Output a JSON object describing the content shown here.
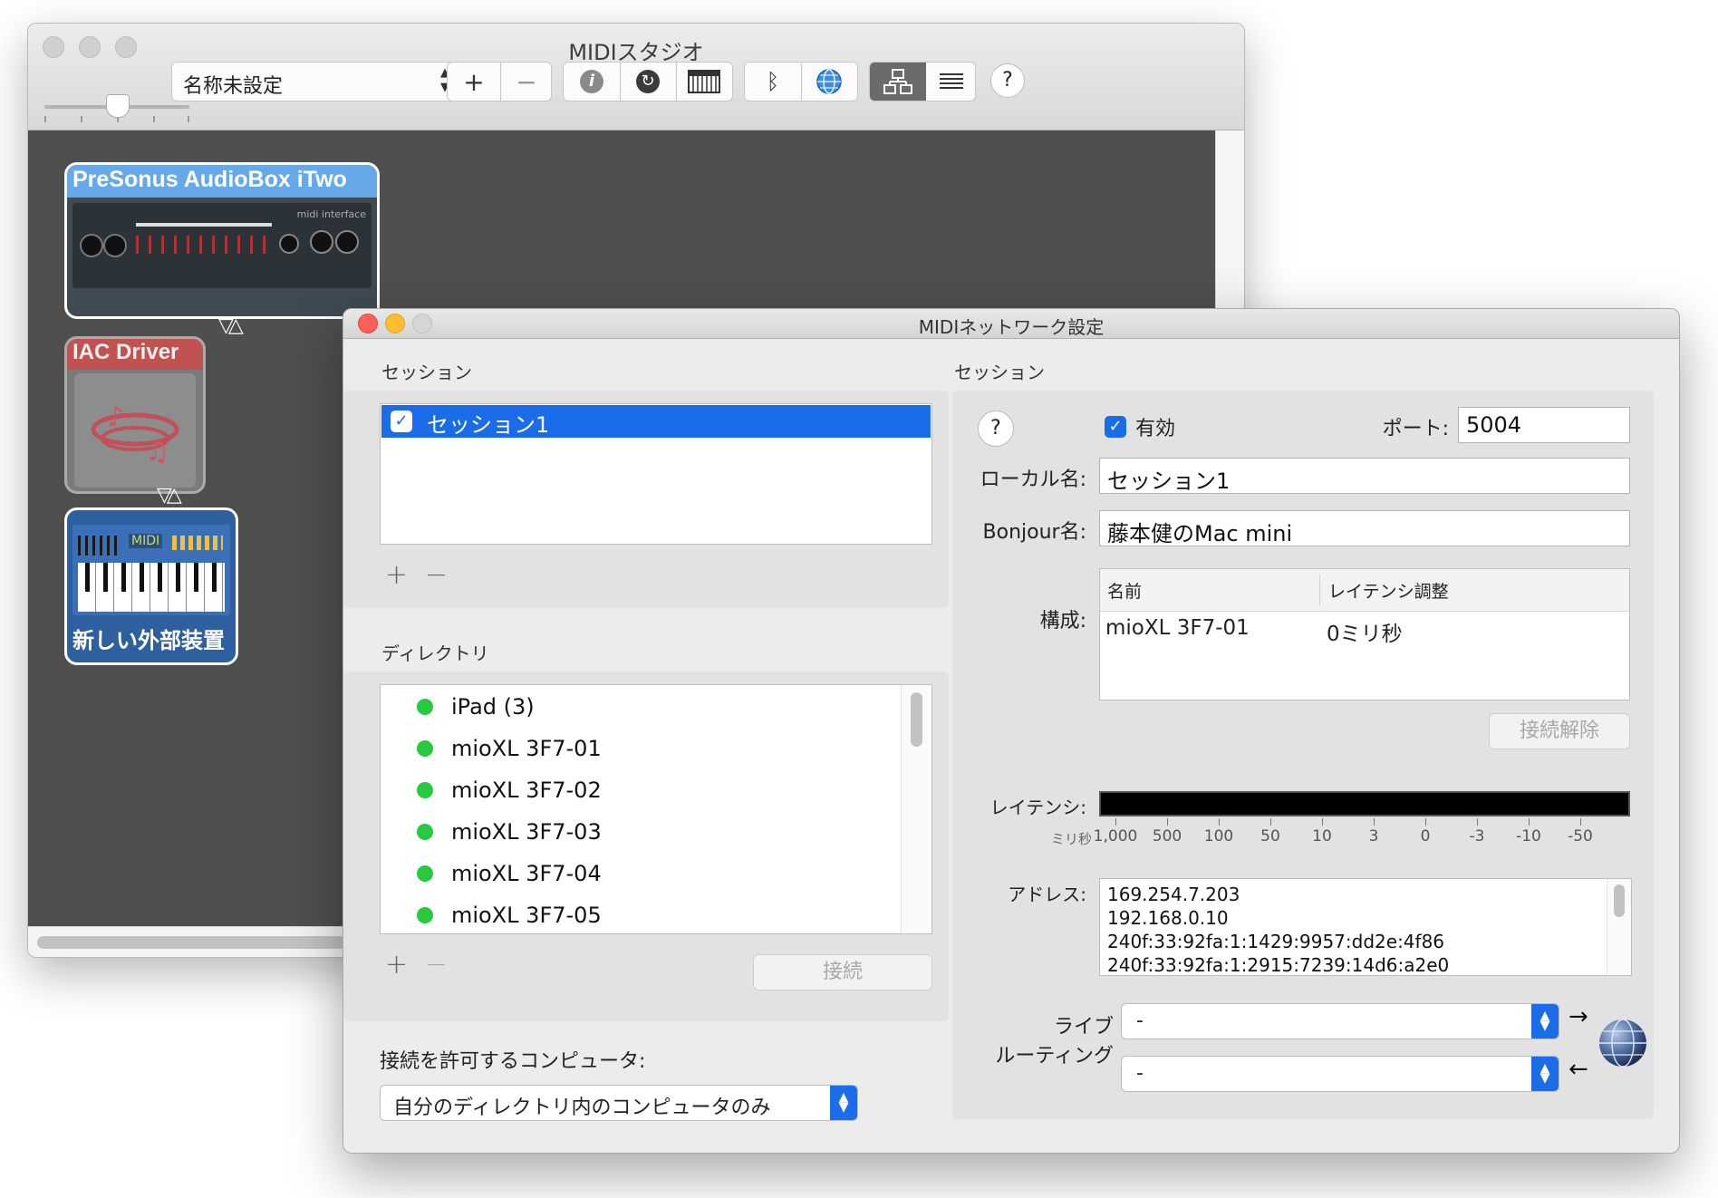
{
  "studio": {
    "title": "MIDIスタジオ",
    "config_select": "名称未設定",
    "add_button": "+",
    "remove_button": "−",
    "help_button": "?",
    "devices": [
      {
        "label": "PreSonus AudioBox iTwo",
        "color": "#66a9e8"
      },
      {
        "label": "IAC Driver",
        "color": "#d94545"
      },
      {
        "label": "新しい外部装置",
        "color": "#2e6fb5"
      }
    ],
    "device_panel_texts": [
      "midi interface",
      "MIDI"
    ]
  },
  "network": {
    "title": "MIDIネットワーク設定",
    "sessions_header": "セッション",
    "sessions": [
      {
        "name": "セッション1",
        "checked": true,
        "selected": true
      }
    ],
    "plus": "+",
    "minus": "−",
    "directory_header": "ディレクトリ",
    "directory": [
      "iPad (3)",
      "mioXL 3F7-01",
      "mioXL 3F7-02",
      "mioXL 3F7-03",
      "mioXL 3F7-04",
      "mioXL 3F7-05"
    ],
    "connect_button": "接続",
    "allow_label": "接続を許可するコンピュータ:",
    "allow_value": "自分のディレクトリ内のコンピュータのみ",
    "session_header": "セッション",
    "help": "?",
    "enabled_label": "有効",
    "enabled": true,
    "port_label": "ポート:",
    "port_value": "5004",
    "local_name_label": "ローカル名:",
    "local_name_value": "セッション1",
    "bonjour_label": "Bonjour名:",
    "bonjour_value": "藤本健のMac mini",
    "config_label": "構成:",
    "participants_headers": [
      "名前",
      "レイテンシ調整"
    ],
    "participants": [
      {
        "name": "mioXL 3F7-01",
        "latency": "0ミリ秒"
      }
    ],
    "disconnect_button": "接続解除",
    "latency_label": "レイテンシ:",
    "latency_unit": "ミリ秒",
    "latency_scale": [
      "1,000",
      "500",
      "100",
      "50",
      "10",
      "3",
      "0",
      "-3",
      "-10",
      "-50"
    ],
    "address_label": "アドレス:",
    "addresses": [
      "169.254.7.203",
      "192.168.0.10",
      "240f:33:92fa:1:1429:9957:dd2e:4f86",
      "240f:33:92fa:1:2915:7239:14d6:a2e0"
    ],
    "live_routing_label_1": "ライブ",
    "live_routing_label_2": "ルーティング",
    "live_routing_in": "-",
    "live_routing_out": "-",
    "accent_color": "#1a6ce8"
  }
}
